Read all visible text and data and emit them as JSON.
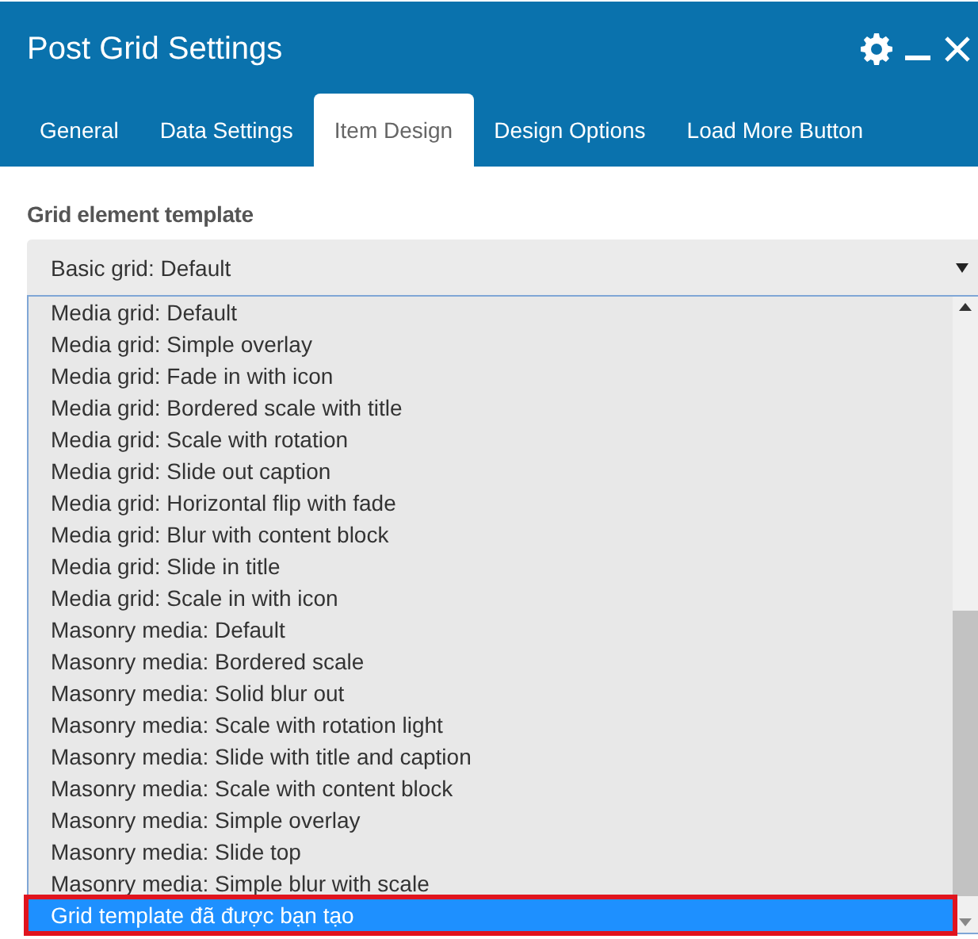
{
  "window": {
    "title": "Post Grid Settings"
  },
  "tabs": [
    {
      "label": "General",
      "selected": false
    },
    {
      "label": "Data Settings",
      "selected": false
    },
    {
      "label": "Item Design",
      "selected": true
    },
    {
      "label": "Design Options",
      "selected": false
    },
    {
      "label": "Load More Button",
      "selected": false
    }
  ],
  "field": {
    "label": "Grid element template",
    "value": "Basic grid: Default",
    "expanded": true
  },
  "options": [
    {
      "label": "Media grid: Default",
      "selected": false,
      "annotated": false
    },
    {
      "label": "Media grid: Simple overlay",
      "selected": false,
      "annotated": false
    },
    {
      "label": "Media grid: Fade in with icon",
      "selected": false,
      "annotated": false
    },
    {
      "label": "Media grid: Bordered scale with title",
      "selected": false,
      "annotated": false
    },
    {
      "label": "Media grid: Scale with rotation",
      "selected": false,
      "annotated": false
    },
    {
      "label": "Media grid: Slide out caption",
      "selected": false,
      "annotated": false
    },
    {
      "label": "Media grid: Horizontal flip with fade",
      "selected": false,
      "annotated": false
    },
    {
      "label": "Media grid: Blur with content block",
      "selected": false,
      "annotated": false
    },
    {
      "label": "Media grid: Slide in title",
      "selected": false,
      "annotated": false
    },
    {
      "label": "Media grid: Scale in with icon",
      "selected": false,
      "annotated": false
    },
    {
      "label": "Masonry media: Default",
      "selected": false,
      "annotated": false
    },
    {
      "label": "Masonry media: Bordered scale",
      "selected": false,
      "annotated": false
    },
    {
      "label": "Masonry media: Solid blur out",
      "selected": false,
      "annotated": false
    },
    {
      "label": "Masonry media: Scale with rotation light",
      "selected": false,
      "annotated": false
    },
    {
      "label": "Masonry media: Slide with title and caption",
      "selected": false,
      "annotated": false
    },
    {
      "label": "Masonry media: Scale with content block",
      "selected": false,
      "annotated": false
    },
    {
      "label": "Masonry media: Simple overlay",
      "selected": false,
      "annotated": false
    },
    {
      "label": "Masonry media: Slide top",
      "selected": false,
      "annotated": false
    },
    {
      "label": "Masonry media: Simple blur with scale",
      "selected": false,
      "annotated": false
    },
    {
      "label": "Grid template đã được bạn tạo",
      "selected": true,
      "annotated": true
    }
  ]
}
